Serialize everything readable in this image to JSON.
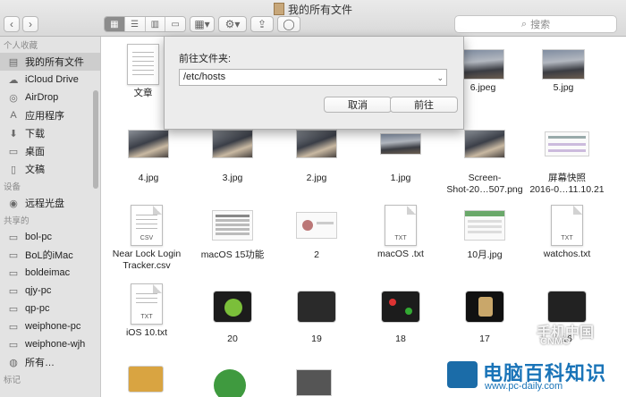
{
  "window": {
    "title": "我的所有文件"
  },
  "search": {
    "placeholder": "搜索"
  },
  "sidebar": {
    "favorites_title": "个人收藏",
    "favorites": [
      {
        "label": "我的所有文件",
        "icon": "documents-icon"
      },
      {
        "label": "iCloud Drive",
        "icon": "cloud-icon"
      },
      {
        "label": "AirDrop",
        "icon": "airdrop-icon"
      },
      {
        "label": "应用程序",
        "icon": "applications-icon"
      },
      {
        "label": "下载",
        "icon": "download-icon"
      },
      {
        "label": "桌面",
        "icon": "desktop-icon"
      },
      {
        "label": "文稿",
        "icon": "document-icon"
      }
    ],
    "devices_title": "设备",
    "devices": [
      {
        "label": "远程光盘",
        "icon": "disc-icon"
      }
    ],
    "shared_title": "共享的",
    "shared": [
      {
        "label": "bol-pc",
        "icon": "computer-icon"
      },
      {
        "label": "BoL的iMac",
        "icon": "computer-icon"
      },
      {
        "label": "boldeimac",
        "icon": "computer-icon"
      },
      {
        "label": "qjy-pc",
        "icon": "computer-icon"
      },
      {
        "label": "qp-pc",
        "icon": "computer-icon"
      },
      {
        "label": "weiphone-pc",
        "icon": "computer-icon"
      },
      {
        "label": "weiphone-wjh",
        "icon": "computer-icon"
      },
      {
        "label": "所有…",
        "icon": "network-icon"
      }
    ],
    "tags_title": "标记"
  },
  "files": [
    {
      "name": "文章"
    },
    {
      "name": "6.jpeg"
    },
    {
      "name": "5.jpg"
    },
    {
      "name": "4.jpg"
    },
    {
      "name": "3.jpg"
    },
    {
      "name": "2.jpg"
    },
    {
      "name": "1.jpg"
    },
    {
      "name": "Screen-\nShot-20…507.png"
    },
    {
      "name": "屏幕快照\n2016-0…11.10.21"
    },
    {
      "name": "Near Lock Login\nTracker.csv"
    },
    {
      "name": "macOS 15功能"
    },
    {
      "name": "2"
    },
    {
      "name": "macOS .txt"
    },
    {
      "name": "10月.jpg"
    },
    {
      "name": "watchos.txt"
    },
    {
      "name": "iOS 10.txt"
    },
    {
      "name": "20"
    },
    {
      "name": "19"
    },
    {
      "name": "18"
    },
    {
      "name": "17"
    },
    {
      "name": "16"
    }
  ],
  "file_icon_text": {
    "csv": "CSV",
    "txt": "TXT"
  },
  "dialog": {
    "label": "前往文件夹:",
    "path_value": "/etc/hosts",
    "cancel_label": "取消",
    "go_label": "前往"
  },
  "watermark": {
    "brand": "电脑百科知识",
    "url": "www.pc-daily.com",
    "secondary_line1": "手机中国",
    "secondary_line2": "CNMO",
    "brand_color": "#1a74b8"
  }
}
